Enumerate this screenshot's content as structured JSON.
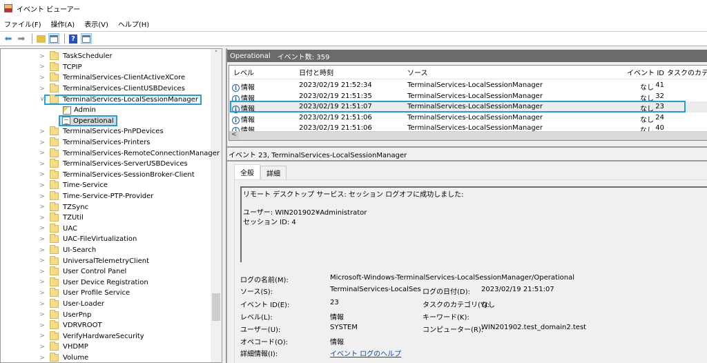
{
  "window": {
    "title": "イベント ビューアー",
    "icon": "event-viewer-icon"
  },
  "menu": [
    "ファイル(F)",
    "操作(A)",
    "表示(V)",
    "ヘルプ(H)"
  ],
  "toolbar": {
    "buttons": [
      "back-arrow-icon",
      "forward-arrow-icon",
      "folder-up-icon",
      "show-hide-console-tree-icon",
      "help-icon",
      "show-hide-action-pane-icon"
    ]
  },
  "tree": {
    "items": [
      {
        "label": "TaskScheduler",
        "type": "folder",
        "expanded": false
      },
      {
        "label": "TCPIP",
        "type": "folder",
        "expanded": false
      },
      {
        "label": "TerminalServices-ClientActiveXCore",
        "type": "folder",
        "expanded": false
      },
      {
        "label": "TerminalServices-ClientUSBDevices",
        "type": "folder",
        "expanded": false
      },
      {
        "label": "TerminalServices-LocalSessionManager",
        "type": "folder",
        "expanded": true,
        "highlighted": true
      },
      {
        "label": "Admin",
        "type": "log-admin",
        "child": true
      },
      {
        "label": "Operational",
        "type": "log",
        "child": true,
        "selected": true,
        "highlighted": true
      },
      {
        "label": "TerminalServices-PnPDevices",
        "type": "folder",
        "expanded": false
      },
      {
        "label": "TerminalServices-Printers",
        "type": "folder",
        "expanded": false
      },
      {
        "label": "TerminalServices-RemoteConnectionManager",
        "type": "folder",
        "expanded": false
      },
      {
        "label": "TerminalServices-ServerUSBDevices",
        "type": "folder",
        "expanded": false
      },
      {
        "label": "TerminalServices-SessionBroker-Client",
        "type": "folder",
        "expanded": false
      },
      {
        "label": "Time-Service",
        "type": "folder",
        "expanded": false
      },
      {
        "label": "Time-Service-PTP-Provider",
        "type": "folder",
        "expanded": false
      },
      {
        "label": "TZSync",
        "type": "folder",
        "expanded": false
      },
      {
        "label": "TZUtil",
        "type": "folder",
        "expanded": false
      },
      {
        "label": "UAC",
        "type": "folder",
        "expanded": false
      },
      {
        "label": "UAC-FileVirtualization",
        "type": "folder",
        "expanded": false
      },
      {
        "label": "UI-Search",
        "type": "folder",
        "expanded": false
      },
      {
        "label": "UniversalTelemetryClient",
        "type": "folder",
        "expanded": false
      },
      {
        "label": "User Control Panel",
        "type": "folder",
        "expanded": false
      },
      {
        "label": "User Device Registration",
        "type": "folder",
        "expanded": false
      },
      {
        "label": "User Profile Service",
        "type": "folder",
        "expanded": false
      },
      {
        "label": "User-Loader",
        "type": "folder",
        "expanded": false
      },
      {
        "label": "UserPnp",
        "type": "folder",
        "expanded": false
      },
      {
        "label": "VDRVROOT",
        "type": "folder",
        "expanded": false
      },
      {
        "label": "VerifyHardwareSecurity",
        "type": "folder",
        "expanded": false
      },
      {
        "label": "VHDMP",
        "type": "folder",
        "expanded": false
      },
      {
        "label": "Volume",
        "type": "folder",
        "expanded": false
      }
    ]
  },
  "events_pane": {
    "log_name": "Operational",
    "count_label": "イベント数: 359",
    "columns": [
      "レベル",
      "日付と時刻",
      "ソース",
      "イベント ID",
      "タスクのカテゴリ"
    ],
    "rows": [
      {
        "level": "情報",
        "datetime": "2023/02/19 21:52:34",
        "source": "TerminalServices-LocalSessionManager",
        "event_id": "41",
        "category": "なし"
      },
      {
        "level": "情報",
        "datetime": "2023/02/19 21:51:35",
        "source": "TerminalServices-LocalSessionManager",
        "event_id": "32",
        "category": "なし"
      },
      {
        "level": "情報",
        "datetime": "2023/02/19 21:51:07",
        "source": "TerminalServices-LocalSessionManager",
        "event_id": "23",
        "category": "なし",
        "selected": true
      },
      {
        "level": "情報",
        "datetime": "2023/02/19 21:51:06",
        "source": "TerminalServices-LocalSessionManager",
        "event_id": "24",
        "category": "なし"
      },
      {
        "level": "情報",
        "datetime": "2023/02/19 21:51:06",
        "source": "TerminalServices-LocalSessionManager",
        "event_id": "40",
        "category": "なし"
      }
    ]
  },
  "detail": {
    "header": "イベント 23, TerminalServices-LocalSessionManager",
    "tabs": [
      "全般",
      "詳細"
    ],
    "active_tab": "全般",
    "description": {
      "line1": "リモート デスクトップ サービス: セッション ログオフに成功しました:",
      "line2": "ユーザー: WIN201902¥Administrator",
      "line3": "セッション ID: 4"
    },
    "properties": {
      "log_name_label": "ログの名前(M):",
      "log_name_value": "Microsoft-Windows-TerminalServices-LocalSessionManager/Operational",
      "source_label": "ソース(S):",
      "source_value": "TerminalServices-LocalSessi",
      "logged_label": "ログの日付(D):",
      "logged_value": "2023/02/19 21:51:07",
      "event_id_label": "イベント ID(E):",
      "event_id_value": "23",
      "task_category_label": "タスクのカテゴリ(Y):",
      "task_category_value": "なし",
      "level_label": "レベル(L):",
      "level_value": "情報",
      "keywords_label": "キーワード(K):",
      "keywords_value": "",
      "user_label": "ユーザー(U):",
      "user_value": "SYSTEM",
      "computer_label": "コンピューター(R):",
      "computer_value": "WIN201902.test_domain2.test",
      "opcode_label": "オペコード(O):",
      "opcode_value": "情報",
      "more_info_label": "詳細情報(I):",
      "more_info_link": "イベント ログのヘルプ"
    }
  },
  "colors": {
    "highlight": "#1ba1e2",
    "pane_header": "#6b6b6b",
    "link": "#0645ad"
  }
}
